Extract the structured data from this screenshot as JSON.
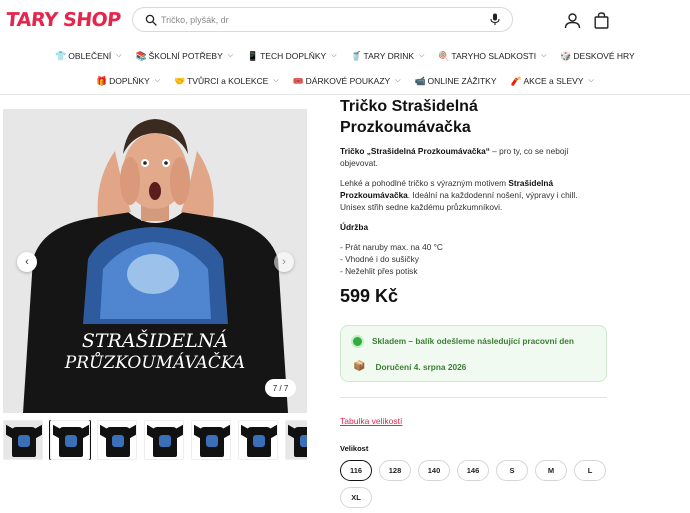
{
  "brand": {
    "logo_text": "TARY SHOP",
    "accent": "#e5254b"
  },
  "search": {
    "placeholder": "Tričko, plyšák, dr"
  },
  "header_icons": [
    "search-icon",
    "mic-icon",
    "account-icon",
    "bag-icon"
  ],
  "nav": {
    "row1": [
      {
        "emoji": "👕",
        "label": "OBLEČENÍ"
      },
      {
        "emoji": "📚",
        "label": "ŠKOLNÍ POTŘEBY"
      },
      {
        "emoji": "📱",
        "label": "TECH DOPLŇKY"
      },
      {
        "emoji": "🥤",
        "label": "TARY DRINK"
      },
      {
        "emoji": "🍭",
        "label": "TARYHO SLADKOSTI"
      },
      {
        "emoji": "🎲",
        "label": "DESKOVÉ HRY"
      }
    ],
    "row2": [
      {
        "emoji": "🎁",
        "label": "DOPLŇKY"
      },
      {
        "emoji": "🤝",
        "label": "TVŮRCI a KOLEKCE"
      },
      {
        "emoji": "🎟️",
        "label": "DÁRKOVÉ POUKAZY"
      },
      {
        "emoji": "📹",
        "label": "ONLINE ZÁŽITKY"
      },
      {
        "emoji": "🧨",
        "label": "AKCE a SLEVY"
      }
    ]
  },
  "gallery": {
    "counter": "7 / 7",
    "thumbnail_count": 7,
    "active_thumbnail": 1,
    "print_text": "STRAŠIDELNÁ PRŮZKOUMÁVAČKA"
  },
  "product": {
    "title": "Tričko Strašidelná Prozkoumávačka",
    "intro_bold": "Tričko „Strašidelná Prozkoumávačka“",
    "intro_rest": " – pro ty, co se nebojí objevovat.",
    "para2_a": "Lehké a pohodlné tričko s výrazným motivem ",
    "para2_bold": "Strašidelná Prozkoumávačka",
    "para2_b": ". Ideální na každodenní nošení, výpravy i chill. Unisex střih sedne každému průzkumníkovi.",
    "care_heading": "Údržba",
    "care": [
      "- Prát naruby max. na 40 °C",
      "- Vhodné i do sušičky",
      "- Nežehlit přes potisk"
    ],
    "price": "599 Kč"
  },
  "stock": {
    "line1": "Skladem – balík odešleme následující pracovní den",
    "line2": "Doručení 4. srpna 2026",
    "color": "#3d7d34"
  },
  "size_chart_link": "Tabulka velikostí",
  "size_label": "Velikost",
  "sizes": [
    "116",
    "128",
    "140",
    "146",
    "S",
    "M",
    "L",
    "XL"
  ],
  "selected_size": "116"
}
